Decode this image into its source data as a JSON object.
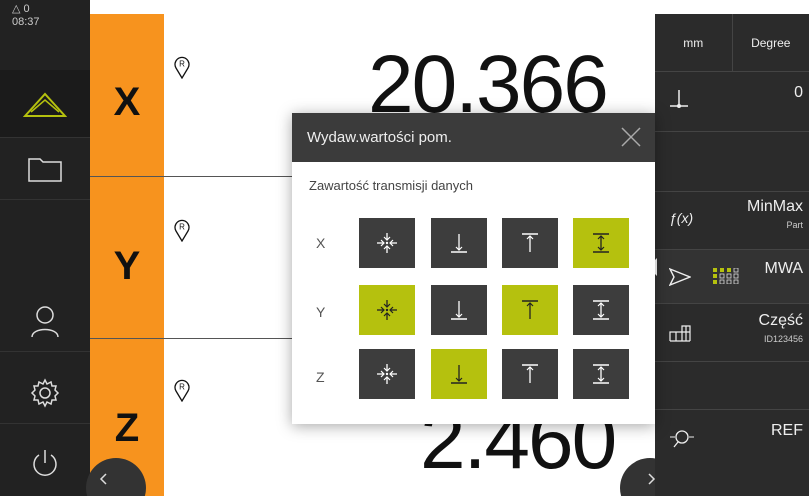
{
  "status": {
    "warning": "△ 0",
    "time": "08:37"
  },
  "axes": [
    {
      "label": "X",
      "value": "20.366"
    },
    {
      "label": "Y",
      "value": ""
    },
    {
      "label": "Z",
      "value": "2.460"
    }
  ],
  "ref_pin_letter": "R",
  "panel": {
    "unit_length": "mm",
    "unit_angle": "Degree",
    "origin_value": "0",
    "func_label": "MinMax",
    "func_sub": "Part",
    "mwa_label": "MWA",
    "part_label": "Część",
    "part_id": "ID123456",
    "ref_label": "REF"
  },
  "dialog": {
    "title": "Wydaw.wartości pom.",
    "subtitle": "Zawartość transmisji danych",
    "rows": [
      {
        "label": "X",
        "selected": [
          false,
          false,
          false,
          true
        ]
      },
      {
        "label": "Y",
        "selected": [
          true,
          false,
          true,
          false
        ]
      },
      {
        "label": "Z",
        "selected": [
          false,
          true,
          false,
          false
        ]
      }
    ],
    "option_icons": [
      "center-icon",
      "min-icon",
      "max-icon",
      "range-icon"
    ]
  },
  "colors": {
    "accent_orange": "#f7931e",
    "accent_green": "#b5c10e",
    "dark": "#222222"
  }
}
